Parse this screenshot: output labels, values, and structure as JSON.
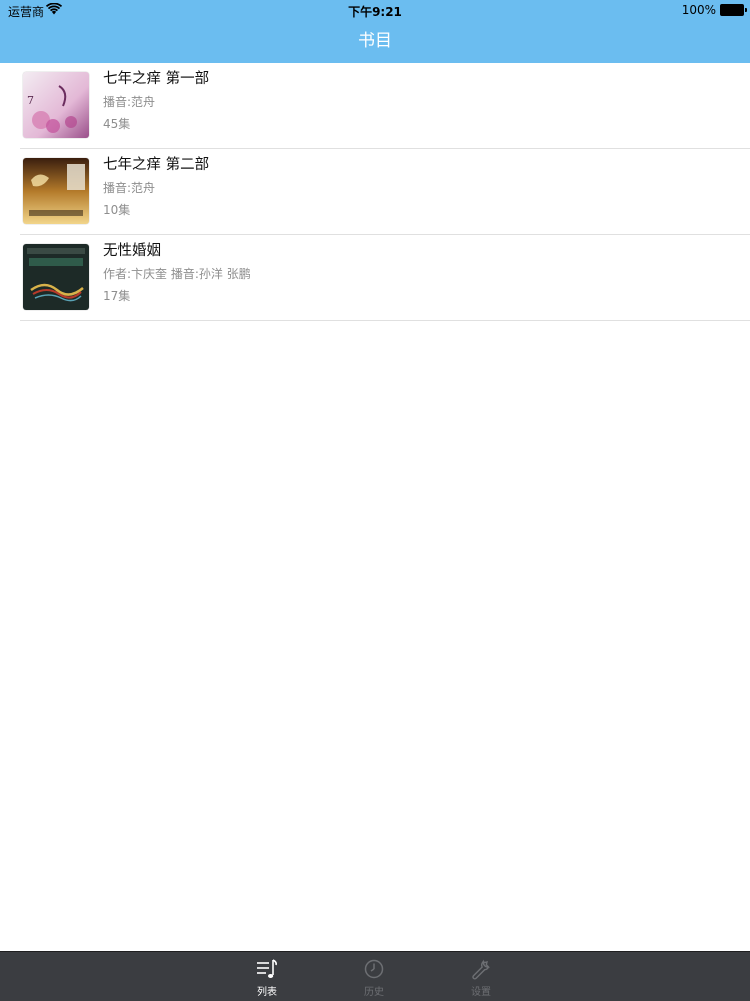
{
  "status_bar": {
    "carrier": "运营商",
    "time": "下午9:21",
    "battery": "100%"
  },
  "nav": {
    "title": "书目"
  },
  "books": [
    {
      "title": "七年之痒 第一部",
      "meta": "播音:范舟",
      "count": "45集",
      "cover_icon": "book-cover-pink-flowers"
    },
    {
      "title": "七年之痒 第二部",
      "meta": "播音:范舟",
      "count": "10集",
      "cover_icon": "book-cover-gold-dark"
    },
    {
      "title": "无性婚姻",
      "meta": "作者:卞庆奎  播音:孙洋 张鹏",
      "count": "17集",
      "cover_icon": "book-cover-dark-green"
    }
  ],
  "tabs": [
    {
      "label": "列表",
      "icon": "music-list-icon",
      "active": true
    },
    {
      "label": "历史",
      "icon": "clock-icon",
      "active": false
    },
    {
      "label": "设置",
      "icon": "wrench-icon",
      "active": false
    }
  ],
  "colors": {
    "nav_bg": "#6bbdf0",
    "tabbar_bg": "#3b3d41",
    "meta_text": "#8e8e8e"
  }
}
